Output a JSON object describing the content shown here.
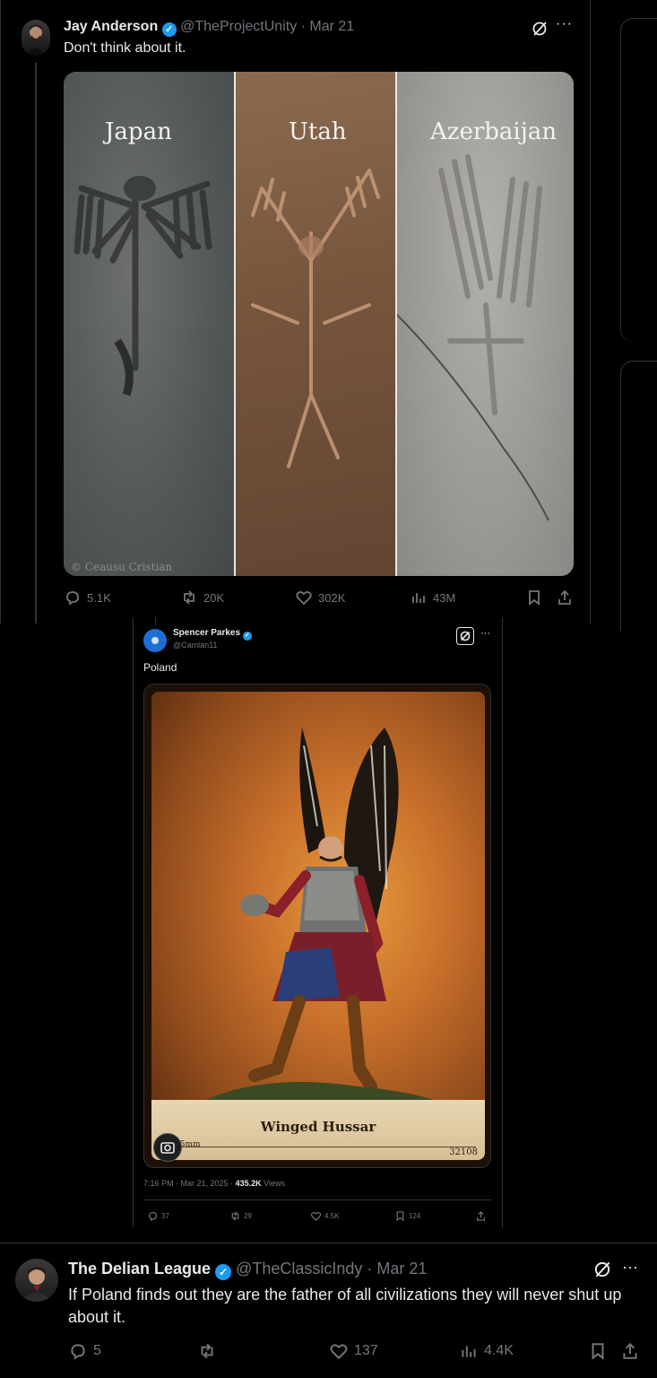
{
  "tweet1": {
    "name": "Jay Anderson",
    "handle": "@TheProjectUnity",
    "date": "· Mar 21",
    "text": "Don't think about it.",
    "image": {
      "panels": [
        "Japan",
        "Utah",
        "Azerbaijan"
      ],
      "credit": "© Ceausu Cristian"
    },
    "stats": {
      "replies": "5.1K",
      "reposts": "20K",
      "likes": "302K",
      "views": "43M"
    }
  },
  "quoted": {
    "name": "Spencer Parkes",
    "handle": "@Camlan11",
    "text": "Poland",
    "card": {
      "title": "Winged Hussar",
      "number": "32108",
      "scale": "75mm"
    },
    "meta_time": "7:16 PM · Mar 21, 2025 ·",
    "meta_views": "435.2K",
    "meta_views_label": "Views",
    "stats": {
      "replies": "37",
      "reposts": "29",
      "likes": "4.5K",
      "bookmarks": "124"
    }
  },
  "tweet2": {
    "name": "The Delian League",
    "handle": "@TheClassicIndy",
    "date": "· Mar 21",
    "text": "If Poland finds out they are the father of all civilizations they will never shut up about it.",
    "stats": {
      "replies": "5",
      "reposts": "",
      "likes": "137",
      "views": "4.4K"
    }
  },
  "colors": {
    "accent": "#1d9bf0",
    "background": "#000000",
    "border": "#2f3336",
    "muted": "#71767b"
  }
}
